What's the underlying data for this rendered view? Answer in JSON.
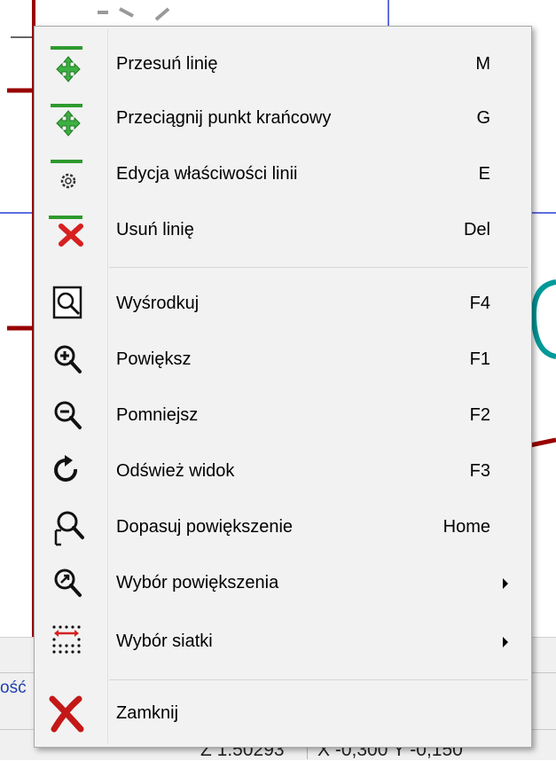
{
  "menu": {
    "items": [
      {
        "label": "Przesuń linię",
        "shortcut": "M",
        "icon": "move-line-icon"
      },
      {
        "label": "Przeciągnij punkt krańcowy",
        "shortcut": "G",
        "icon": "drag-endpoint-icon"
      },
      {
        "label": "Edycja właściwości linii",
        "shortcut": "E",
        "icon": "edit-line-properties-icon"
      },
      {
        "label": "Usuń linię",
        "shortcut": "Del",
        "icon": "delete-line-icon"
      },
      {
        "label": "Wyśrodkuj",
        "shortcut": "F4",
        "icon": "center-icon"
      },
      {
        "label": "Powiększ",
        "shortcut": "F1",
        "icon": "zoom-in-icon"
      },
      {
        "label": "Pomniejsz",
        "shortcut": "F2",
        "icon": "zoom-out-icon"
      },
      {
        "label": "Odśwież widok",
        "shortcut": "F3",
        "icon": "refresh-icon"
      },
      {
        "label": "Dopasuj powiększenie",
        "shortcut": "Home",
        "icon": "zoom-fit-icon"
      },
      {
        "label": "Wybór powiększenia",
        "shortcut": "",
        "icon": "zoom-select-icon",
        "submenu": true
      },
      {
        "label": "Wybór siatki",
        "shortcut": "",
        "icon": "grid-select-icon",
        "submenu": true
      },
      {
        "label": "Zamknij",
        "shortcut": "",
        "icon": "close-icon"
      }
    ]
  },
  "statusbar": {
    "left_text": "ość",
    "zoom_text": "Z 1.50293",
    "coords_text": "X -0,300  Y -0,150"
  },
  "colors": {
    "wire_red": "#990000",
    "grid_blue": "#2a3fd8",
    "teal": "#009999",
    "icon_green": "#2e9a2e",
    "icon_red": "#d62020"
  }
}
